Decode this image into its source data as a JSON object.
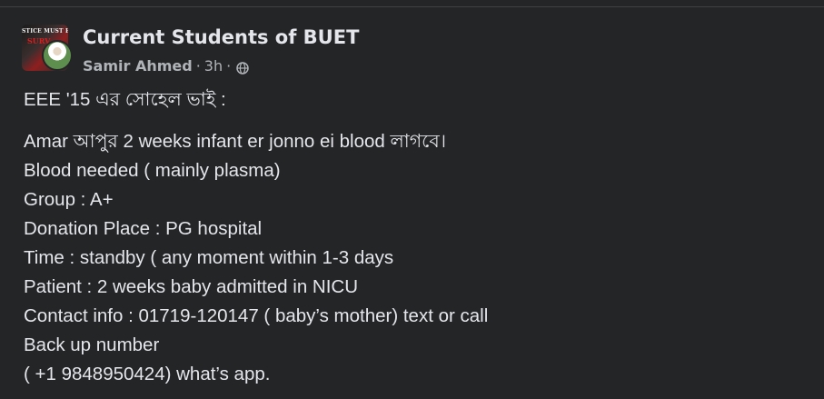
{
  "group": {
    "name": "Current Students of BUET",
    "avatar_text_top": "STICE MUST BE",
    "avatar_text_red": "SURV"
  },
  "post_meta": {
    "author": "Samir Ahmed",
    "separator": "·",
    "time": "3h",
    "audience_icon": "globe-icon"
  },
  "post": {
    "lines": [
      "EEE '15 এর সোহেল ভাই :",
      "Amar আপুর 2 weeks infant er jonno ei blood লাগবে।",
      "Blood needed ( mainly plasma)",
      "Group : A+",
      "Donation Place : PG hospital",
      "Time : standby ( any moment within 1-3 days",
      "Patient : 2 weeks baby admitted in NICU",
      "Contact info : 01719-120147 ( baby’s mother) text or call",
      "Back up number",
      "( +1 9848950424) what’s app."
    ]
  },
  "colors": {
    "background": "#242526",
    "primary_text": "#e4e6eb",
    "secondary_text": "#b0b3b8"
  }
}
